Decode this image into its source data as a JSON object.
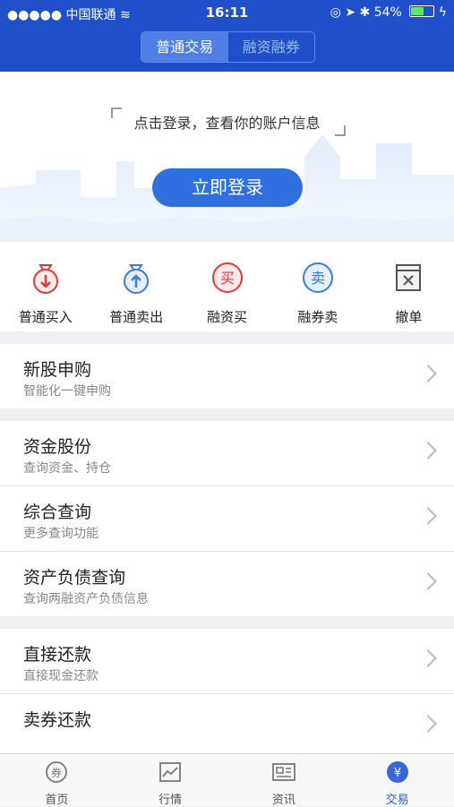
{
  "status_bar": {
    "carrier": "●●●●● 中国联通",
    "time": "16:11",
    "battery": "54%"
  },
  "segments": [
    {
      "label": "普通交易"
    },
    {
      "label": "融资融券"
    }
  ],
  "banner": {
    "hint": "点击登录，查看你的账户信息",
    "login_button": "立即登录"
  },
  "actions": [
    {
      "label": "普通买入",
      "icon": "buy-bag-icon",
      "glyph": "↓"
    },
    {
      "label": "普通卖出",
      "icon": "sell-bag-icon",
      "glyph": "↑"
    },
    {
      "label": "融资买",
      "icon": "margin-buy-icon",
      "glyph": "买"
    },
    {
      "label": "融券卖",
      "icon": "short-sell-icon",
      "glyph": "卖"
    },
    {
      "label": "撤单",
      "icon": "cancel-order-icon",
      "glyph": "✕"
    }
  ],
  "groups": [
    [
      {
        "title": "新股申购",
        "subtitle": "智能化一键申购"
      }
    ],
    [
      {
        "title": "资金股份",
        "subtitle": "查询资金、持仓"
      },
      {
        "title": "综合查询",
        "subtitle": "更多查询功能"
      },
      {
        "title": "资产负债查询",
        "subtitle": "查询两融资产负债信息"
      }
    ],
    [
      {
        "title": "直接还款",
        "subtitle": "直接现金还款"
      },
      {
        "title": "卖券还款",
        "subtitle": ""
      }
    ]
  ],
  "tabs": [
    {
      "label": "首页",
      "icon": "home-icon",
      "glyph": "券"
    },
    {
      "label": "行情",
      "icon": "market-icon",
      "glyph": ""
    },
    {
      "label": "资讯",
      "icon": "news-icon",
      "glyph": ""
    },
    {
      "label": "交易",
      "icon": "trade-icon",
      "glyph": "¥"
    }
  ],
  "colors": {
    "header": "#1f4fc9",
    "accent": "#2f6fe0",
    "buy_red": "#e03a3a",
    "sell_blue": "#3a7be0"
  }
}
